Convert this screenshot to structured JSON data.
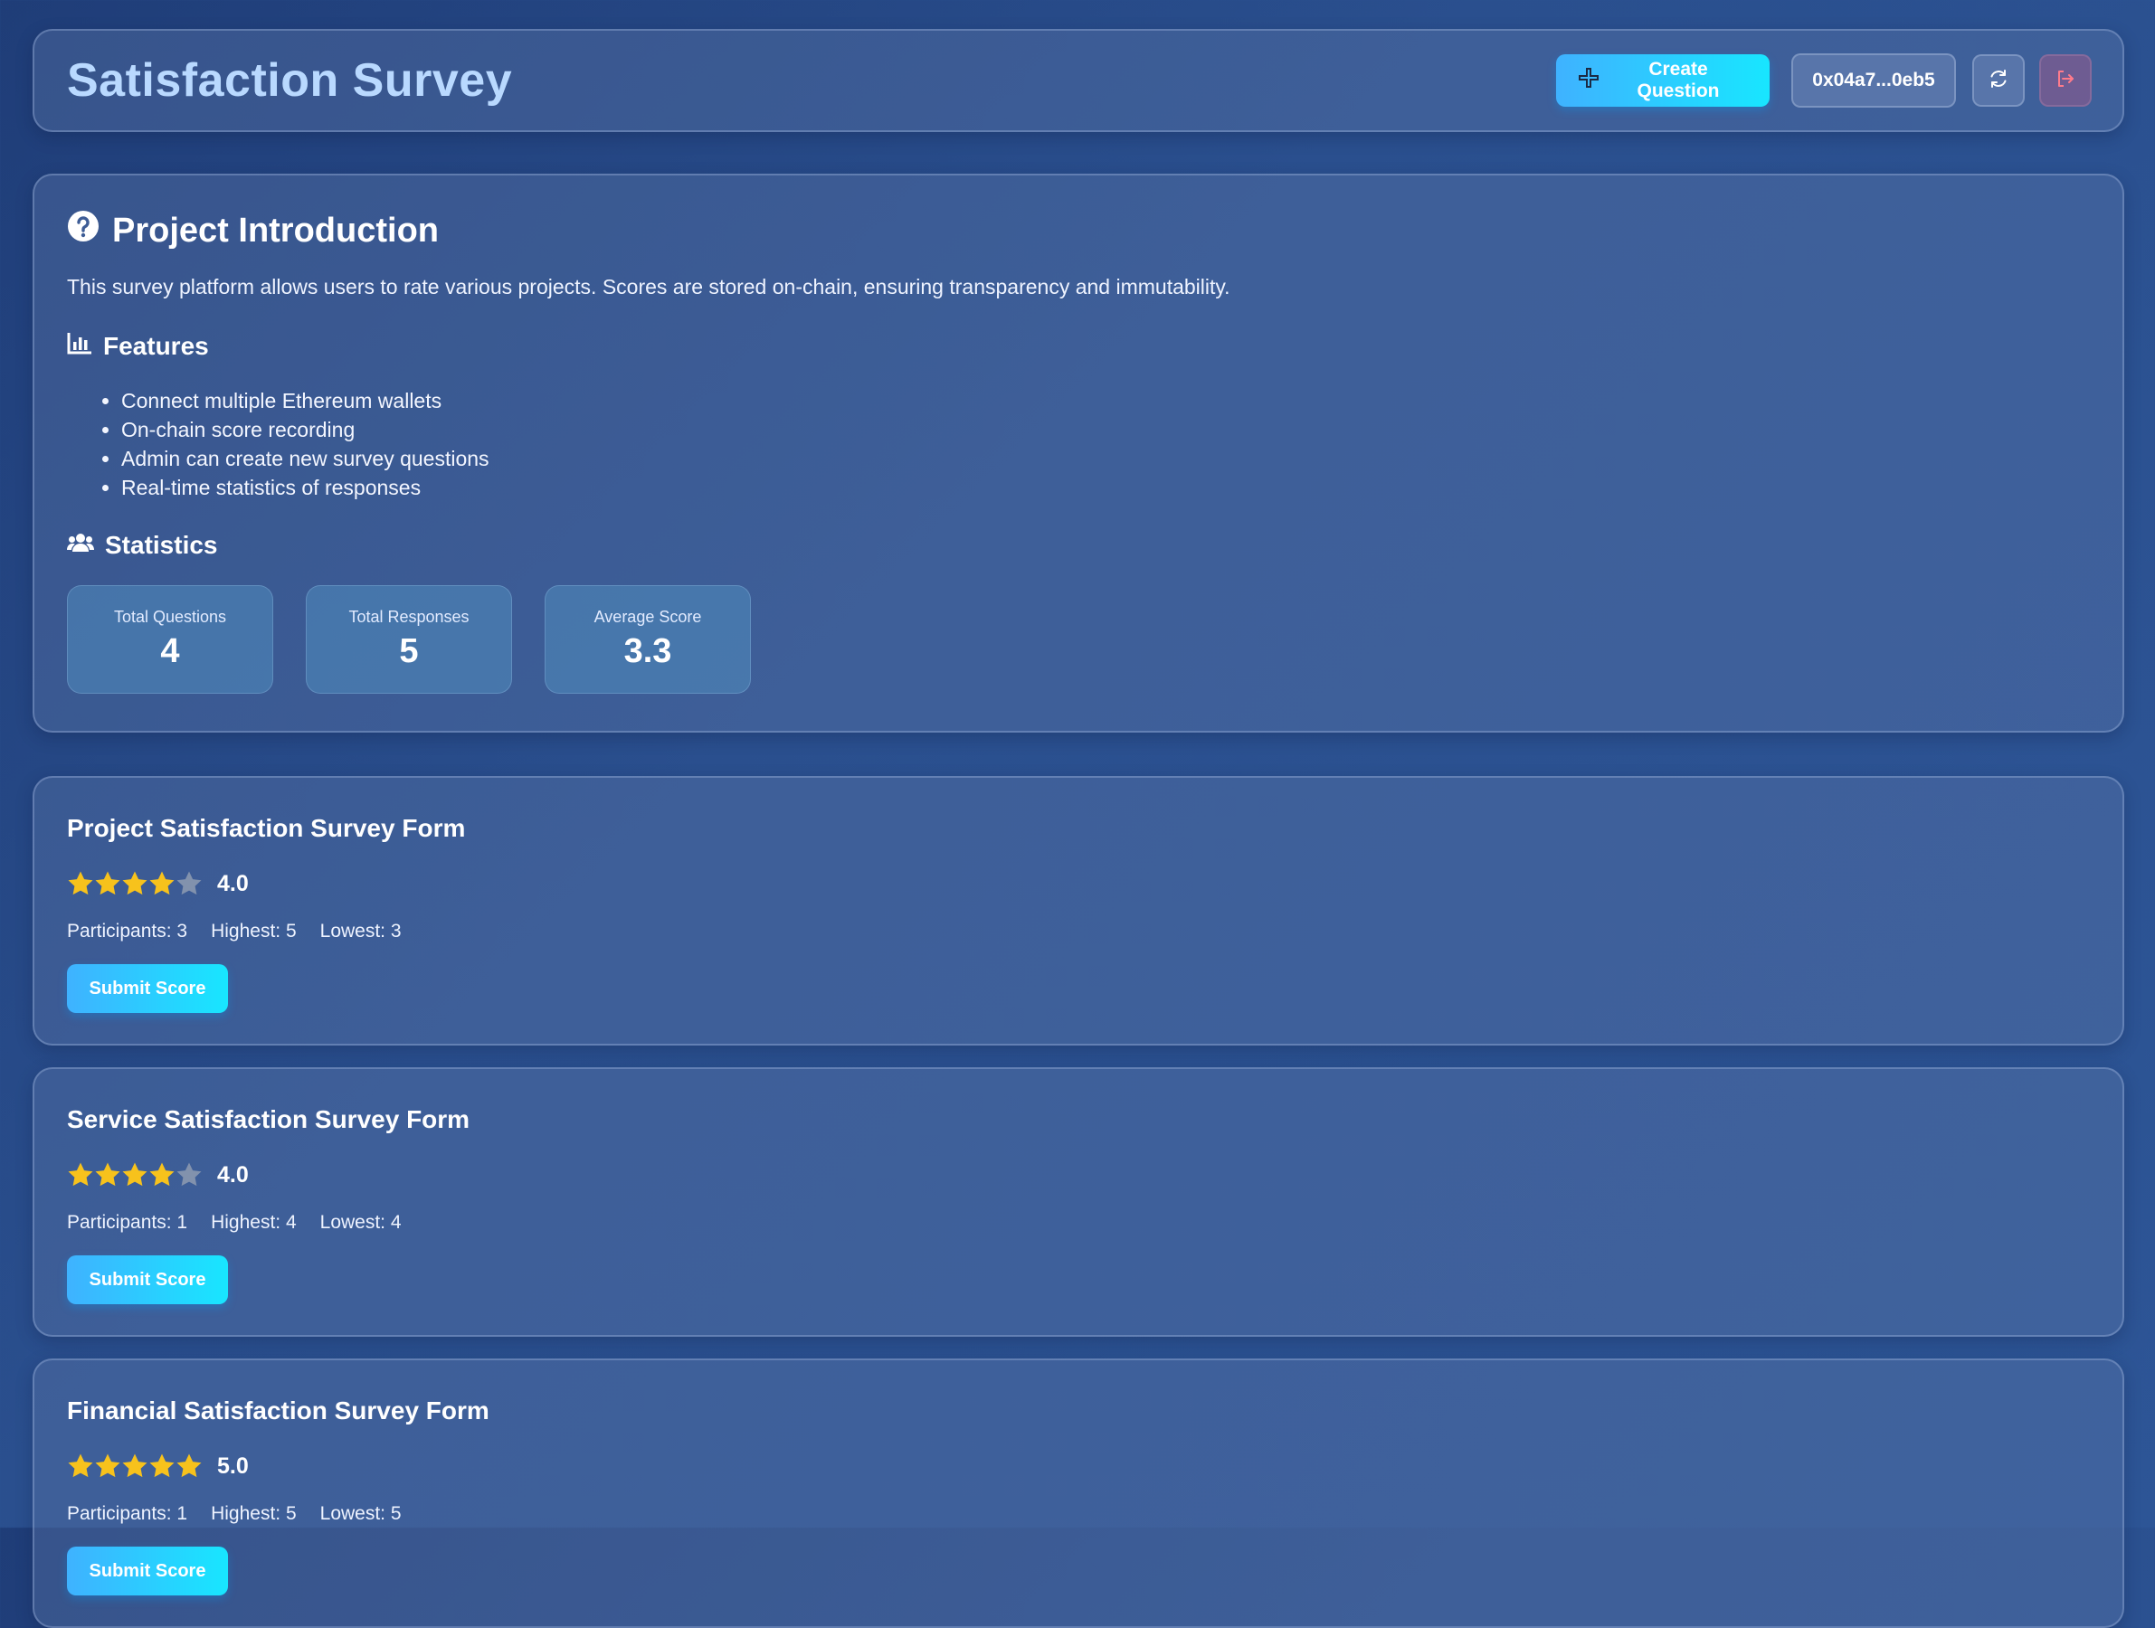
{
  "header": {
    "title": "Satisfaction Survey",
    "create_label": "Create Question",
    "wallet_address": "0x04a7...0eb5",
    "refresh_icon": "refresh-icon",
    "logout_icon": "logout-icon"
  },
  "intro": {
    "title": "Project Introduction",
    "description": "This survey platform allows users to rate various projects. Scores are stored on-chain, ensuring transparency and immutability.",
    "features_title": "Features",
    "features": [
      "Connect multiple Ethereum wallets",
      "On-chain score recording",
      "Admin can create new survey questions",
      "Real-time statistics of responses"
    ],
    "stats_title": "Statistics",
    "stats": [
      {
        "label": "Total Questions",
        "value": "4"
      },
      {
        "label": "Total Responses",
        "value": "5"
      },
      {
        "label": "Average Score",
        "value": "3.3"
      }
    ]
  },
  "questions": [
    {
      "title": "Project Satisfaction Survey Form",
      "stars_filled": 4,
      "stars_total": 5,
      "score": "4.0",
      "participants": "Participants: 3",
      "highest": "Highest: 5",
      "lowest": "Lowest: 3",
      "submit_label": "Submit Score"
    },
    {
      "title": "Service Satisfaction Survey Form",
      "stars_filled": 4,
      "stars_total": 5,
      "score": "4.0",
      "participants": "Participants: 1",
      "highest": "Highest: 4",
      "lowest": "Lowest: 4",
      "submit_label": "Submit Score"
    },
    {
      "title": "Financial Satisfaction Survey Form",
      "stars_filled": 5,
      "stars_total": 5,
      "score": "5.0",
      "participants": "Participants: 1",
      "highest": "Highest: 5",
      "lowest": "Lowest: 5",
      "submit_label": "Submit Score"
    }
  ],
  "colors": {
    "star_filled": "#f7c21c",
    "star_empty": "#8292ad",
    "accent": "#18e6ff",
    "title": "#b9d9ff"
  }
}
